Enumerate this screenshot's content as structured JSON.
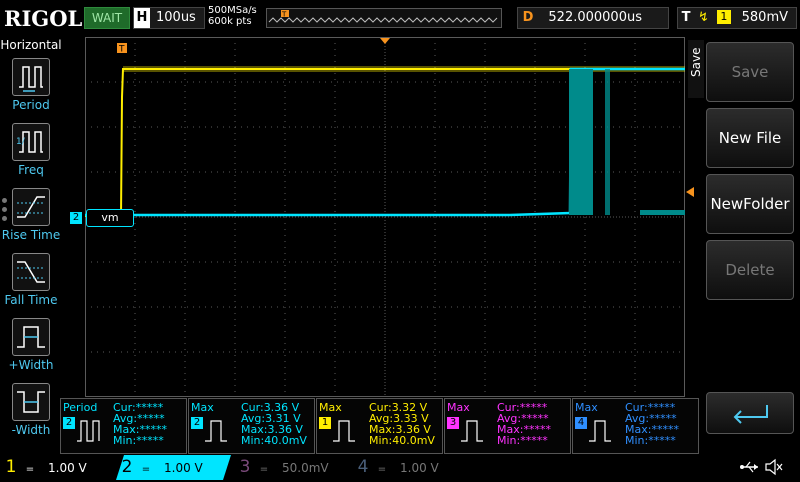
{
  "topbar": {
    "logo": "RIGOL",
    "status": "WAIT",
    "horizontal_label": "H",
    "timebase": "100us",
    "sample_rate": "500MSa/s",
    "memory_depth": "600k pts",
    "overview_trigger_marker": "T",
    "delay_label": "D",
    "delay_value": "522.000000us",
    "trigger_label": "T",
    "trigger_edge": "↯",
    "trigger_channel": "1",
    "trigger_level": "580mV"
  },
  "left_panel": {
    "title": "Horizontal",
    "items": [
      {
        "label": "Period",
        "icon": "period-icon"
      },
      {
        "label": "Freq",
        "icon": "frequency-icon"
      },
      {
        "label": "Rise Time",
        "icon": "rise-time-icon"
      },
      {
        "label": "Fall Time",
        "icon": "fall-time-icon"
      },
      {
        "label": "+Width",
        "icon": "positive-width-icon"
      },
      {
        "label": "-Width",
        "icon": "negative-width-icon"
      }
    ]
  },
  "waveform": {
    "trigger_marker_top": "T",
    "ch2_marker": "2",
    "ch2_label": "vm",
    "colors": {
      "ch1": "#ffee00",
      "ch2": "#00e5ff",
      "ch3": "#ff33ff",
      "ch4": "#2f8fff",
      "grid": "#5a5a5a",
      "trigger": "#f7931e"
    }
  },
  "right_menu": {
    "side_label": "Save",
    "buttons": [
      {
        "label": "Save",
        "enabled": false
      },
      {
        "label": "New File",
        "enabled": true
      },
      {
        "label": "NewFolder",
        "enabled": true
      },
      {
        "label": "Delete",
        "enabled": false
      }
    ],
    "enter_icon": "enter-return-icon"
  },
  "measurements": [
    {
      "title": "Period",
      "channel": "2",
      "color": "#00e5ff",
      "rows": [
        "Cur:*****",
        "Avg:*****",
        "Max:*****",
        "Min:*****"
      ]
    },
    {
      "title": "Max",
      "channel": "2",
      "color": "#00e5ff",
      "rows": [
        "Cur:3.36 V",
        "Avg:3.31 V",
        "Max:3.36 V",
        "Min:40.0mV"
      ]
    },
    {
      "title": "Max",
      "channel": "1",
      "color": "#ffee00",
      "rows": [
        "Cur:3.32 V",
        "Avg:3.33 V",
        "Max:3.36 V",
        "Min:40.0mV"
      ]
    },
    {
      "title": "Max",
      "channel": "3",
      "color": "#ff33ff",
      "rows": [
        "Cur:*****",
        "Avg:*****",
        "Max:*****",
        "Min:*****"
      ]
    },
    {
      "title": "Max",
      "channel": "4",
      "color": "#2f8fff",
      "rows": [
        "Cur:*****",
        "Avg:*****",
        "Max:*****",
        "Min:*****"
      ]
    }
  ],
  "channels": [
    {
      "num": "1",
      "coupling": "=",
      "scale": "1.00 V",
      "color": "#ffee00",
      "active": false
    },
    {
      "num": "2",
      "coupling": "=",
      "scale": "1.00 V",
      "color": "#00e5ff",
      "active": true
    },
    {
      "num": "3",
      "coupling": "=",
      "scale": "50.0mV",
      "color": "#7a4a7a",
      "active": false
    },
    {
      "num": "4",
      "coupling": "=",
      "scale": "1.00 V",
      "color": "#4a5f7a",
      "active": false
    }
  ],
  "status_icons": [
    "usb-icon",
    "speaker-muted-icon"
  ]
}
